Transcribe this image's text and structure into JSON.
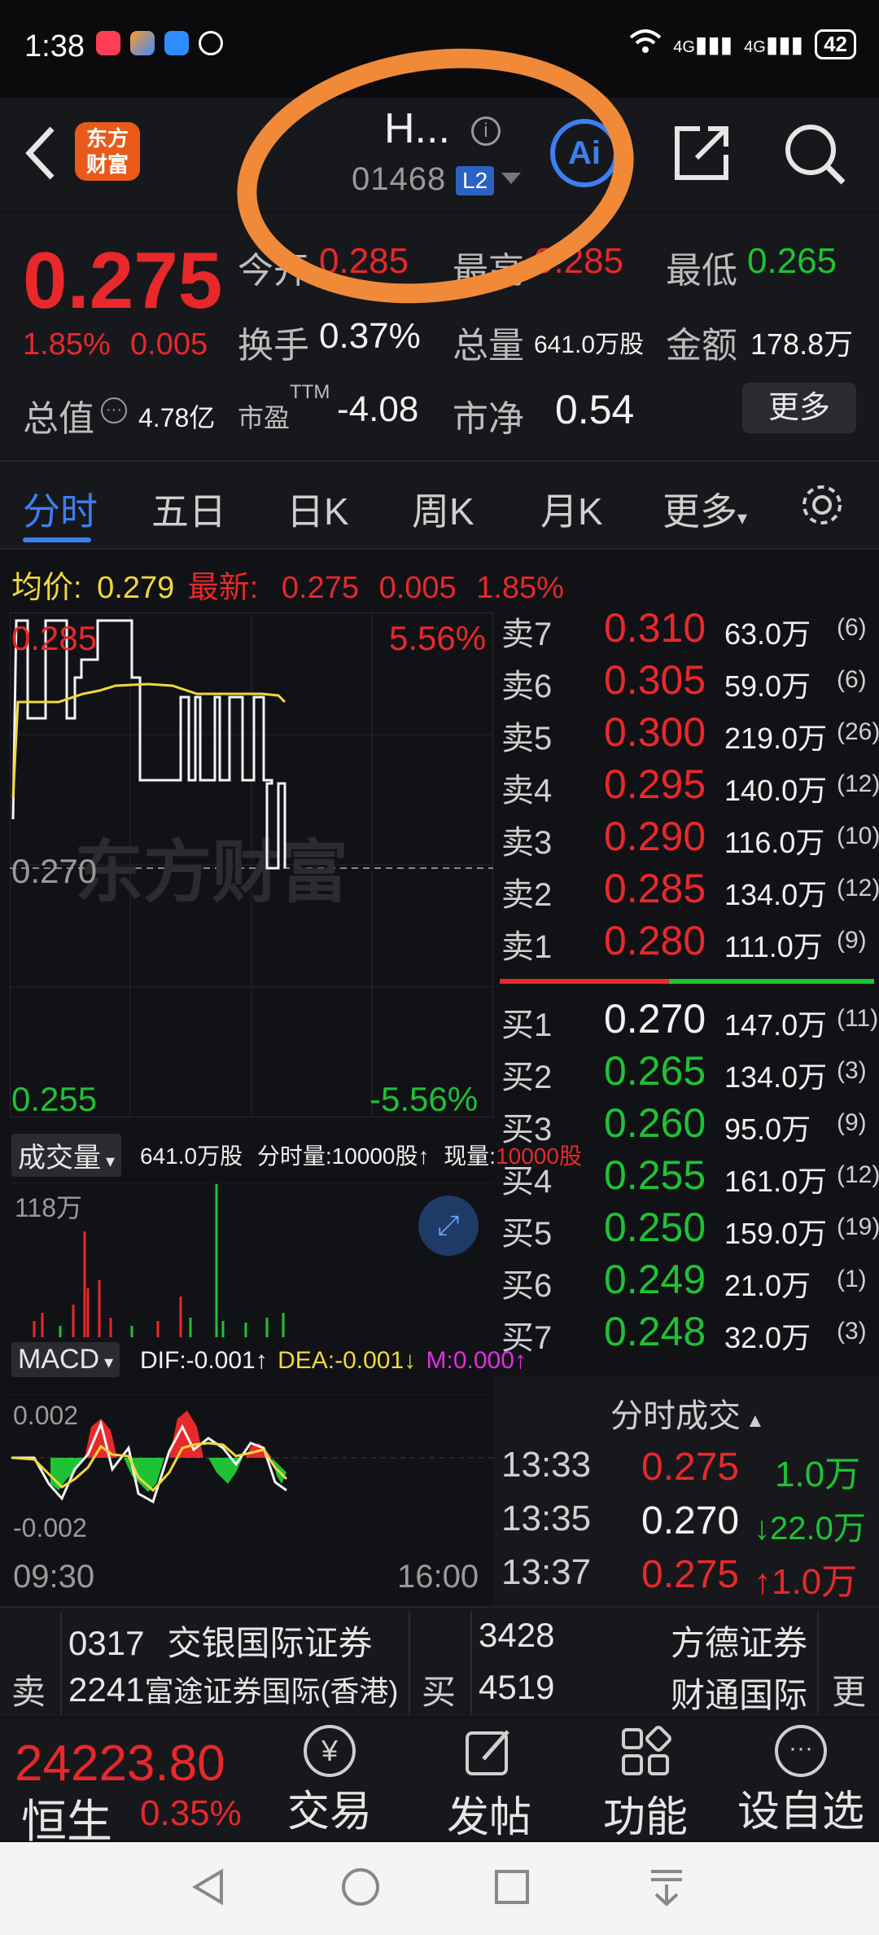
{
  "status": {
    "time": "1:38",
    "battery": "42",
    "net1": "4G",
    "net2": "4G"
  },
  "header": {
    "name": "H...",
    "code": "01468",
    "badge": "L2",
    "logo": "东方财富",
    "ai_label": "Ai"
  },
  "quote": {
    "price": "0.275",
    "change_pct": "1.85%",
    "change": "0.005",
    "open_label": "今开",
    "open": "0.285",
    "high_label": "最高",
    "high": "0.285",
    "low_label": "最低",
    "low": "0.265",
    "turnover_label": "换手",
    "turnover": "0.37%",
    "volume_label": "总量",
    "volume": "641.0万股",
    "amount_label": "金额",
    "amount": "178.8万",
    "mktcap_label": "总值",
    "mktcap": "4.78亿",
    "pe_label": "市盈",
    "pe_sup": "TTM",
    "pe": "-4.08",
    "pb_label": "市净",
    "pb": "0.54",
    "more": "更多"
  },
  "tabs": [
    "分时",
    "五日",
    "日K",
    "周K",
    "月K",
    "更多"
  ],
  "avg": {
    "avg_label": "均价:",
    "avg": "0.279",
    "last_label": "最新:",
    "last": "0.275",
    "chg": "0.005",
    "pct": "1.85%"
  },
  "chart": {
    "top_price": "0.285",
    "top_pct": "5.56%",
    "mid_price": "0.270",
    "bottom_price": "0.255",
    "bottom_pct": "-5.56%",
    "watermark": "东方财富",
    "time_start": "09:30",
    "time_end": "16:00"
  },
  "volume": {
    "label": "成交量",
    "total": "641.0万股",
    "per_min": "分时量:10000股↑",
    "cur_label": "现量:",
    "cur": "10000股",
    "max": "118万"
  },
  "macd": {
    "label": "MACD",
    "dif": "DIF:-0.001↑",
    "dea": "DEA:-0.001↓",
    "m": "M:0.000↑",
    "top": "0.002",
    "bottom": "-0.002"
  },
  "asks": [
    {
      "label": "卖7",
      "price": "0.310",
      "vol": "63.0万",
      "n": "(6)"
    },
    {
      "label": "卖6",
      "price": "0.305",
      "vol": "59.0万",
      "n": "(6)"
    },
    {
      "label": "卖5",
      "price": "0.300",
      "vol": "219.0万",
      "n": "(26)"
    },
    {
      "label": "卖4",
      "price": "0.295",
      "vol": "140.0万",
      "n": "(12)"
    },
    {
      "label": "卖3",
      "price": "0.290",
      "vol": "116.0万",
      "n": "(10)"
    },
    {
      "label": "卖2",
      "price": "0.285",
      "vol": "134.0万",
      "n": "(12)"
    },
    {
      "label": "卖1",
      "price": "0.280",
      "vol": "111.0万",
      "n": "(9)"
    }
  ],
  "bids": [
    {
      "label": "买1",
      "price": "0.270",
      "vol": "147.0万",
      "n": "(11)"
    },
    {
      "label": "买2",
      "price": "0.265",
      "vol": "134.0万",
      "n": "(3)"
    },
    {
      "label": "买3",
      "price": "0.260",
      "vol": "95.0万",
      "n": "(9)"
    },
    {
      "label": "买4",
      "price": "0.255",
      "vol": "161.0万",
      "n": "(12)"
    },
    {
      "label": "买5",
      "price": "0.250",
      "vol": "159.0万",
      "n": "(19)"
    },
    {
      "label": "买6",
      "price": "0.249",
      "vol": "21.0万",
      "n": "(1)"
    },
    {
      "label": "买7",
      "price": "0.248",
      "vol": "32.0万",
      "n": "(3)"
    }
  ],
  "ticks_title": "分时成交",
  "ticks": [
    {
      "time": "13:33",
      "price": "0.275",
      "vol": "1.0万"
    },
    {
      "time": "13:35",
      "price": "0.270",
      "vol": "↓22.0万"
    },
    {
      "time": "13:37",
      "price": "0.275",
      "vol": "↑1.0万"
    }
  ],
  "brokers": {
    "sell_label": "卖",
    "buy_label": "买",
    "more": "更",
    "sell": [
      {
        "code": "0317",
        "name": "交银国际证券"
      },
      {
        "code": "2241",
        "name": "富途证券国际(香港)"
      }
    ],
    "buy": [
      {
        "code": "3428",
        "name": "方德证券"
      },
      {
        "code": "4519",
        "name": "财通国际"
      }
    ]
  },
  "bottom": {
    "index_value": "24223.80",
    "index_name": "恒生",
    "index_pct": "0.35%",
    "trade": "交易",
    "post": "发帖",
    "func": "功能",
    "watch": "设自选"
  },
  "colors": {
    "up": "#e8282b",
    "down": "#1ec235",
    "accent": "#3c7ff0",
    "avg_line": "#f1d73c",
    "annotation": "#f08a38"
  }
}
